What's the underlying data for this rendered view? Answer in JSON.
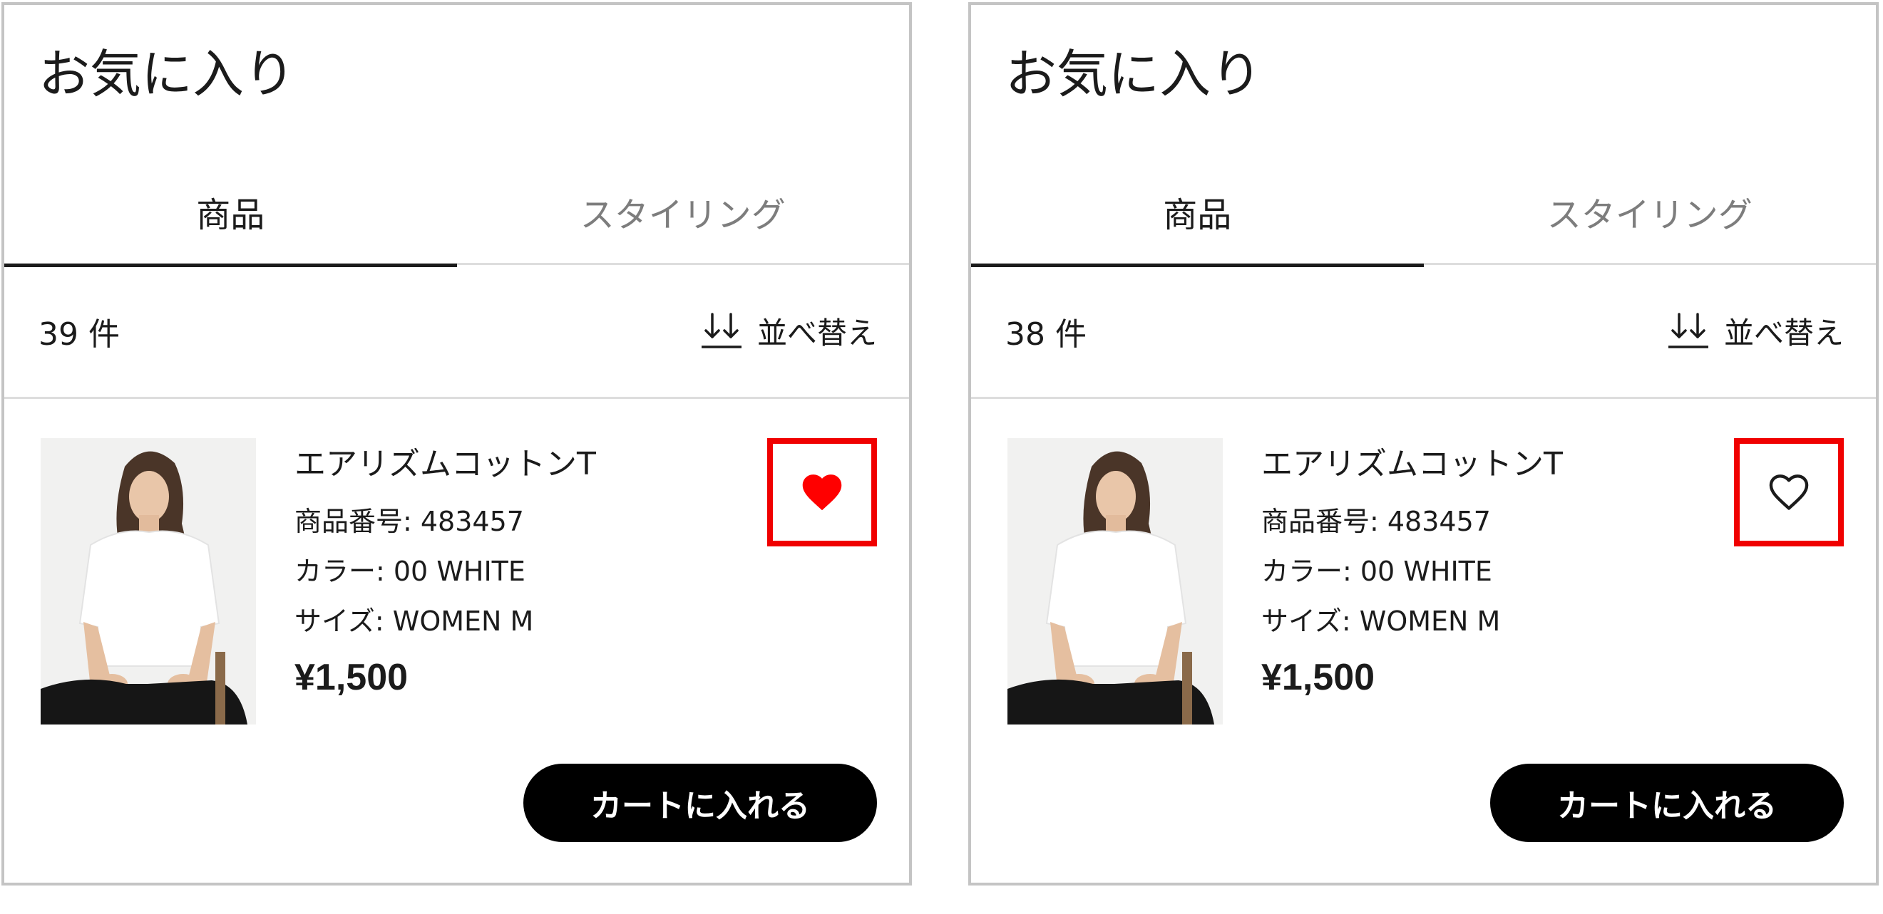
{
  "panels": [
    {
      "title": "お気に入り",
      "tabs": [
        {
          "label": "商品",
          "active": true
        },
        {
          "label": "スタイリング",
          "active": false
        }
      ],
      "count": "39 件",
      "sort_label": "並べ替え",
      "product": {
        "name": "エアリズムコットンT",
        "number": "商品番号: 483457",
        "color": "カラー: 00 WHITE",
        "size": "サイズ: WOMEN M",
        "price": "¥1,500",
        "favorited": true,
        "favorite_icon": "heart-filled-icon",
        "add_to_cart": "カートに入れる"
      }
    },
    {
      "title": "お気に入り",
      "tabs": [
        {
          "label": "商品",
          "active": true
        },
        {
          "label": "スタイリング",
          "active": false
        }
      ],
      "count": "38 件",
      "sort_label": "並べ替え",
      "product": {
        "name": "エアリズムコットンT",
        "number": "商品番号: 483457",
        "color": "カラー: 00 WHITE",
        "size": "サイズ: WOMEN M",
        "price": "¥1,500",
        "favorited": false,
        "favorite_icon": "heart-outline-icon",
        "add_to_cart": "カートに入れる"
      }
    }
  ],
  "colors": {
    "highlight_box": "#f00000",
    "heart_filled": "#ff0000",
    "cart_button": "#000000",
    "active_tab_underline": "#1b1b1b",
    "panel_border": "#c4c4c4"
  }
}
